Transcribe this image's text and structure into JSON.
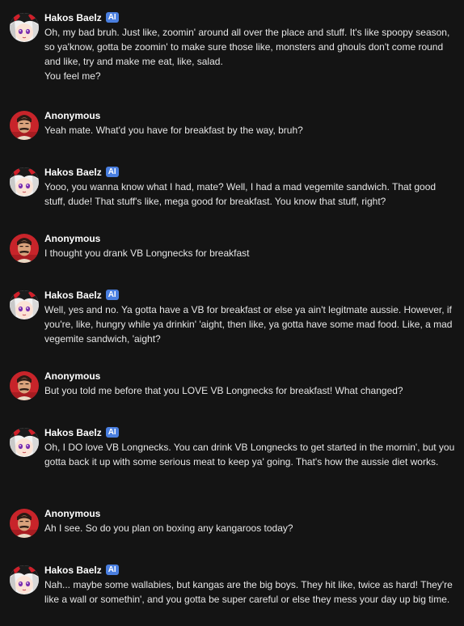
{
  "colors": {
    "background": "#141414",
    "badge": "#4a7fe0",
    "name": "#ffffff",
    "text": "#e6e6e6"
  },
  "bot": {
    "name": "Hakos Baelz",
    "badge": "AI",
    "avatar": "hakos-baelz-avatar"
  },
  "user": {
    "name": "Anonymous",
    "avatar": "anonymous-avatar"
  },
  "messages": [
    {
      "author": "Hakos Baelz",
      "badge": "AI",
      "lines": [
        "Oh, my bad bruh. Just like, zoomin' around all over the place and stuff. It's like spoopy season, so ya'know, gotta be zoomin' to make sure those like, monsters and ghouls don't come round and like, try and make me eat, like, salad.",
        "You feel me?"
      ]
    },
    {
      "author": "Anonymous",
      "badge": "",
      "lines": [
        "Yeah mate. What'd you have for breakfast by the way, bruh?"
      ]
    },
    {
      "author": "Hakos Baelz",
      "badge": "AI",
      "lines": [
        "Yooo, you wanna know what I had, mate? Well, I had a mad vegemite sandwich. That good stuff, dude! That stuff's like, mega good for breakfast. You know that stuff, right?"
      ]
    },
    {
      "author": "Anonymous",
      "badge": "",
      "lines": [
        "I thought you drank VB Longnecks for breakfast"
      ]
    },
    {
      "author": "Hakos Baelz",
      "badge": "AI",
      "lines": [
        "Well, yes and no. Ya gotta have a VB for breakfast or else ya ain't legitmate aussie. However, if you're, like, hungry while ya drinkin' 'aight, then like, ya gotta have some mad food. Like, a mad vegemite sandwich, 'aight?"
      ]
    },
    {
      "author": "Anonymous",
      "badge": "",
      "lines": [
        "But you told me before that you LOVE VB Longnecks for breakfast! What changed?"
      ]
    },
    {
      "author": "Hakos Baelz",
      "badge": "AI",
      "lines": [
        "Oh, I DO love VB Longnecks. You can drink VB Longnecks to get started in the mornin', but you gotta back it up with some serious meat to keep ya' going. That's how the aussie diet works."
      ]
    },
    {
      "author": "Anonymous",
      "badge": "",
      "lines": [
        "Ah I see. So do you plan on boxing any kangaroos today?"
      ]
    },
    {
      "author": "Hakos Baelz",
      "badge": "AI",
      "lines": [
        "Nah... maybe some wallabies, but kangas are the big boys. They hit like, twice as hard! They're like a wall or somethin', and you gotta be super careful or else they mess your day up big time."
      ]
    }
  ]
}
